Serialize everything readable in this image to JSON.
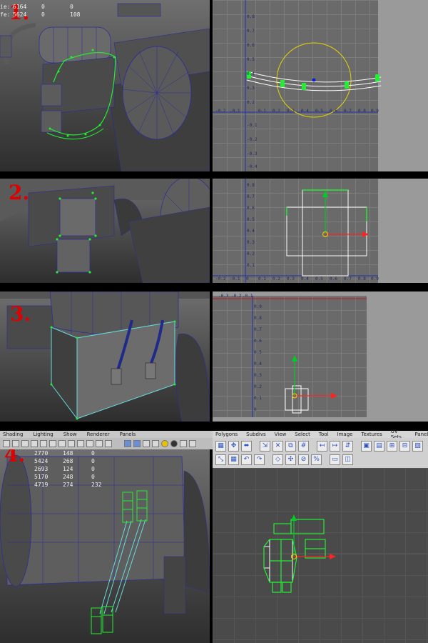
{
  "steps": [
    "1.",
    "2.",
    "3.",
    "4."
  ],
  "panel1": {
    "hud_labels": [
      "ie:",
      "fe:"
    ],
    "hud_rows": [
      [
        "6164",
        "0",
        "0"
      ],
      [
        "5624",
        "0",
        "108"
      ]
    ],
    "uv_ticks_y": [
      "0.8",
      "0.7",
      "0.6",
      "0.5",
      "0.4",
      "0.3",
      "0.2"
    ],
    "uv_ticks_x": [
      "-0.2",
      "-0.1",
      "0",
      "0.1",
      "0.2",
      "0.3",
      "0.4",
      "0.5",
      "0.6",
      "0.7",
      "0.8",
      "0.9"
    ],
    "uv_ticks_neg": [
      "-0.1",
      "-0.2",
      "-0.3",
      "-0.4"
    ]
  },
  "panel2": {
    "uv_ticks_y": [
      "0.8",
      "0.7",
      "0.6",
      "0.5",
      "0.4",
      "0.3",
      "0.2",
      "0.1"
    ],
    "uv_ticks_x": [
      "-0.2",
      "-0.1",
      "0",
      "0.1",
      "0.2",
      "0.3",
      "0.4",
      "0.5",
      "0.6",
      "0.7",
      "0.8",
      "0.9"
    ]
  },
  "panel3": {
    "uv_ticks_x": [
      "-0.3",
      "-0.2",
      "-0.1"
    ],
    "uv_ticks_y": [
      "0.9",
      "0.8",
      "0.7",
      "0.6",
      "0.5",
      "0.4",
      "0.3",
      "0.2",
      "0.1",
      "0"
    ]
  },
  "panel4": {
    "menu": [
      "Shading",
      "Lighting",
      "Show",
      "Renderer",
      "Panels"
    ],
    "hud_rows": [
      [
        "2770",
        "148",
        "0"
      ],
      [
        "5424",
        "268",
        "0"
      ],
      [
        "2693",
        "124",
        "0"
      ],
      [
        "5170",
        "248",
        "0"
      ],
      [
        "4719",
        "274",
        "232"
      ]
    ],
    "uv_menu": [
      "Polygons",
      "Subdivs",
      "View",
      "Select",
      "Tool",
      "Image",
      "Textures",
      "UV Sets",
      "Panels"
    ]
  },
  "colors": {
    "wire": "#22ee33",
    "shell": "#ffffff",
    "axis_up": "#00cc22",
    "axis_right": "#ff2222",
    "pivot": "#ffcc00",
    "manip": "#e3d400"
  },
  "icons": [
    "toolbar-icon",
    "uv-tool-icon"
  ]
}
